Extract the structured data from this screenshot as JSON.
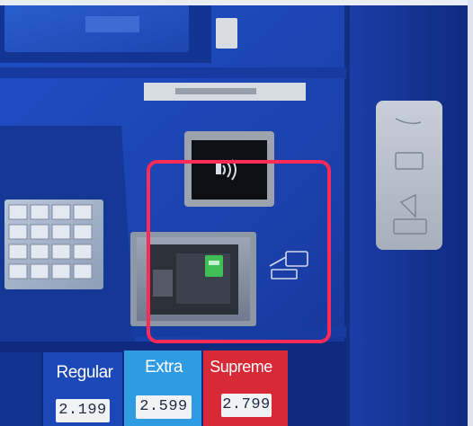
{
  "grades": {
    "regular": {
      "label": "Regular",
      "price": "2.199"
    },
    "extra": {
      "label": "Extra",
      "price": "2.599"
    },
    "supreme": {
      "label": "Supreme",
      "price": "2.799"
    }
  },
  "colors": {
    "pump_blue": "#1d46b4",
    "extra_blue": "#2f9be3",
    "supreme_red": "#d82a36",
    "highlight": "#ff2a55"
  },
  "icons": [
    "contactless-tap-icon",
    "card-insert-icon",
    "keypad-icon"
  ]
}
